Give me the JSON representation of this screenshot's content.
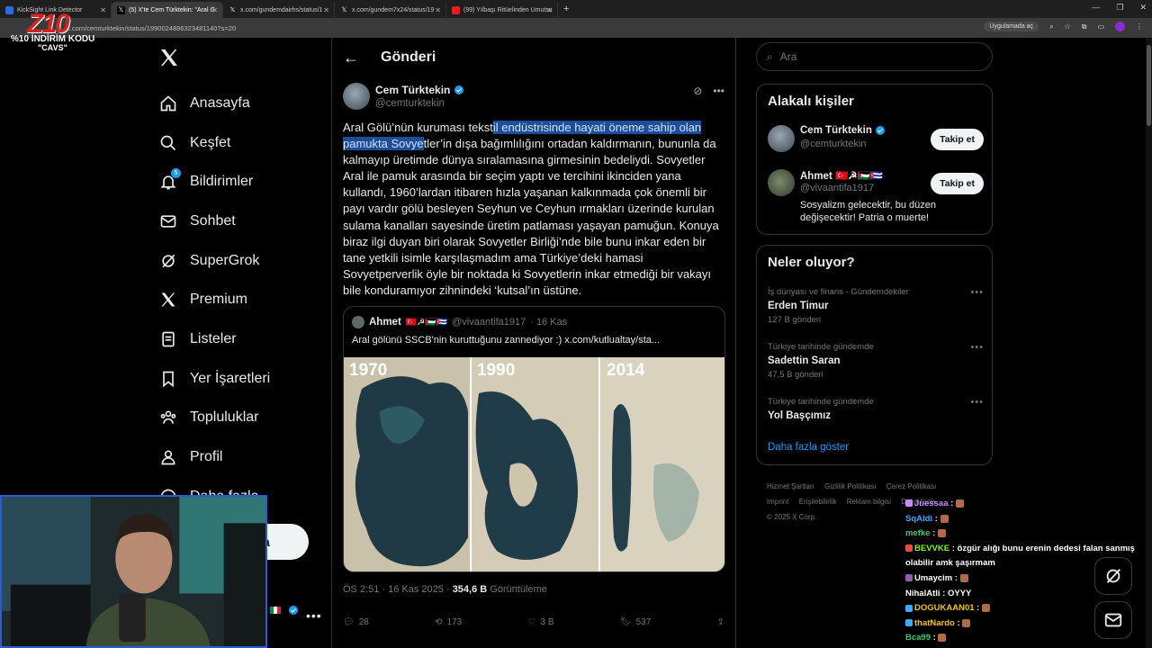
{
  "browser": {
    "tabs": [
      {
        "title": "KickSight Link Detector",
        "icon_color": "#2b6cd9",
        "active": false
      },
      {
        "title": "(5) X'te Cem Türktekin: \"Aral G",
        "icon_color": "#000000",
        "active": true
      },
      {
        "title": "x.com/gundemdairhs/status/1",
        "icon_color": "#000000",
        "active": false
      },
      {
        "title": "x.com/gundem7x24/status/19",
        "icon_color": "#000000",
        "active": false
      },
      {
        "title": "(99) Yılbaşı Ritüelinden Umutsu",
        "icon_color": "#e02020",
        "active": false
      }
    ],
    "url": "x.com/cemturktekin/status/1990024886323481140?s=20",
    "app_pill": "Uygulamada aç",
    "overlay_promo": "%10 İNDİRİM KODU",
    "overlay_code": "\"CAVS\""
  },
  "nav": {
    "items": [
      {
        "label": "Anasayfa",
        "icon": "home-icon"
      },
      {
        "label": "Keşfet",
        "icon": "search-icon"
      },
      {
        "label": "Bildirimler",
        "icon": "bell-icon",
        "badge": "5"
      },
      {
        "label": "Sohbet",
        "icon": "mail-icon"
      },
      {
        "label": "SuperGrok",
        "icon": "grok-icon"
      },
      {
        "label": "Premium",
        "icon": "x-icon"
      },
      {
        "label": "Listeler",
        "icon": "list-icon"
      },
      {
        "label": "Yer İşaretleri",
        "icon": "bookmark-icon"
      },
      {
        "label": "Topluluklar",
        "icon": "people-icon"
      },
      {
        "label": "Profil",
        "icon": "person-icon"
      },
      {
        "label": "Daha fazla",
        "icon": "more-circle-icon"
      }
    ],
    "post_button_partial": "a"
  },
  "main": {
    "header_title": "Gönderi",
    "author_name": "Cem Türktekin",
    "author_handle": "@cemturktekin",
    "text_before": "Aral Gölü’nün kuruması tekst",
    "text_highlight": "il endüstrisinde hayati öneme sahip olan pamukta Sovye",
    "text_after": "tler’in dışa bağımlılığını ortadan kaldırmanın, bununla da kalmayıp üretimde dünya sıralamasına girmesinin bedeliydi. Sovyetler Aral ile pamuk arasında bir seçim yaptı ve tercihini ikinciden yana kullandı, 1960’lardan itibaren hızla yaşanan kalkınmada çok önemli bir payı vardır gölü besleyen Seyhun ve Ceyhun ırmakları üzerinde kurulan sulama kanalları sayesinde üretim patlaması yaşayan pamuğun. Konuya biraz ilgi duyan biri olarak Sovyetler Birliği’nde bile bunu inkar eden bir tane yetkili isimle karşılaşmadım ama Türkiye’deki hamasi Sovyetperverlik öyle bir noktada ki Sovyetlerin inkar etmediği bir vakayı bile konduramıyor zihnindeki ‘kutsal’ın üstüne.",
    "quote": {
      "name": "Ahmet",
      "flags": "🇹🇷☭🇵🇸🇨🇺",
      "handle": "@vivaantifa1917",
      "date": "· 16 Kas",
      "text": "Aral gölünü SSCB'nin kuruttuğunu zannediyor :)  x.com/kutlualtay/sta...",
      "years": [
        "1970",
        "1990",
        "2014"
      ]
    },
    "meta_time": "ÖS 2:51 · 16 Kas 2025 · ",
    "meta_views": "354,6 B",
    "meta_views_label": " Görüntüleme",
    "actions": {
      "replies": "28",
      "reposts": "173",
      "likes": "3 B",
      "bookmarks": "537"
    }
  },
  "sidebar": {
    "search_placeholder": "Ara",
    "related_title": "Alakalı kişiler",
    "people": [
      {
        "name": "Cem Türktekin",
        "handle": "@cemturktekin",
        "bio": "",
        "follow": "Takip et",
        "verified": true
      },
      {
        "name": "Ahmet 🇹🇷☭🇵🇸🇨🇺",
        "handle": "@vivaantifa1917",
        "bio": "Sosyalizm gelecektir, bu düzen değişecektir! Patria o muerte!",
        "follow": "Takip et",
        "verified": false
      }
    ],
    "trends_title": "Neler oluyor?",
    "trends": [
      {
        "category": "İş dünyası ve finans · Gündemdekiler",
        "title": "Erden Timur",
        "count": "127 B gönderi"
      },
      {
        "category": "Türkiye tarihinde gündemde",
        "title": "Sadettin Saran",
        "count": "47,5 B gönderi"
      },
      {
        "category": "Türkiye tarihinde gündemde",
        "title": "Yol Başçımız",
        "count": ""
      }
    ],
    "show_more": "Daha fazla göster",
    "footer": [
      "Hizmet Şartları",
      "Gizlilik Politikası",
      "Çerez Politikası",
      "Imprint",
      "Erişilebilirlik",
      "Reklam bilgisi",
      "Daha fazla",
      "© 2025 X Corp."
    ]
  },
  "chat": [
    {
      "user": "Juessaa",
      "color": "#c68bff",
      "msg": ""
    },
    {
      "user": "SqAldi",
      "color": "#3fa9ff",
      "msg": ""
    },
    {
      "user": "mefke",
      "color": "#2ecc71",
      "msg": ""
    },
    {
      "user": "BEVVKE",
      "color": "#7cfc00",
      "msg": "özgür alığı bunu erenin dedesi falan sanmış olabilir amk şaşırmam"
    },
    {
      "user": "Umaycim",
      "color": "#ffffff",
      "msg": ""
    },
    {
      "user": "NihalAtli",
      "color": "#ffffff",
      "msg": "OYYY"
    },
    {
      "user": "DOGUKAAN01",
      "color": "#f1c40f",
      "msg": ""
    },
    {
      "user": "thatNardo",
      "color": "#f1c40f",
      "msg": ""
    },
    {
      "user": "Bca99",
      "color": "#2ecc71",
      "msg": ""
    }
  ]
}
